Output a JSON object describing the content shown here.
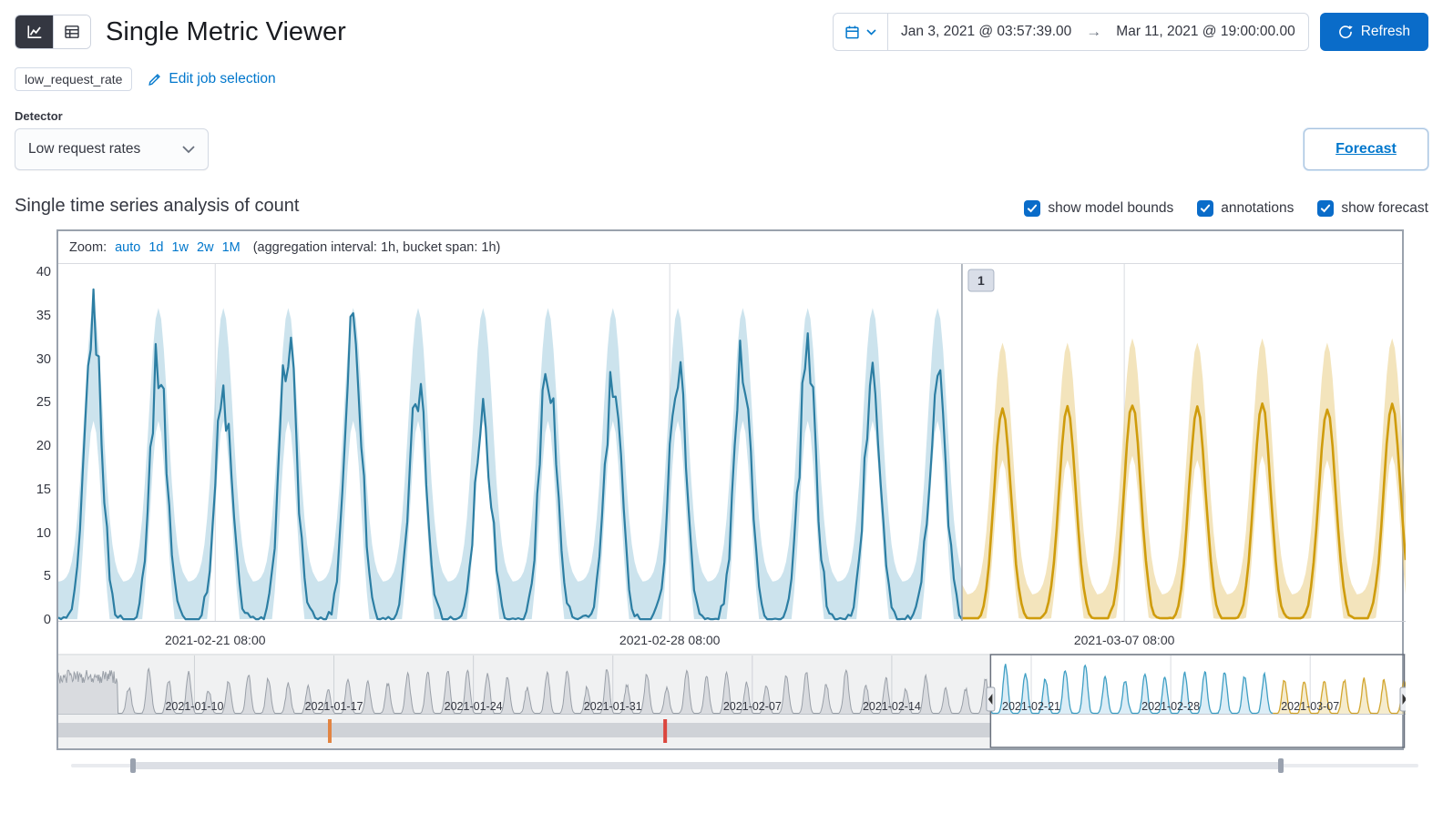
{
  "colors": {
    "primary": "#0a6cc9",
    "link": "#0077cc",
    "text": "#343741",
    "gridline": "#d8dbe0",
    "panel_border": "#9aa2ad",
    "actual_line": "#2c7ea3",
    "actual_band": "#8fc0d6",
    "forecast_line": "#cf9c0c",
    "forecast_band": "#e8ca7a",
    "context_line": "#9aa0a9",
    "context_fill": "#e4e5e9",
    "context_actual_line": "#3f9fc4",
    "context_actual_fill": "#bfdfee",
    "context_forecast_line": "#d2a52e",
    "context_forecast_fill": "#eedfad",
    "annotation_badge_bg": "#d9dee8",
    "swimlane_track": "#d9dbe0",
    "mask": "#98a0ab",
    "selection_border": "#69707d"
  },
  "header": {
    "title": "Single Metric Viewer",
    "refresh_label": "Refresh",
    "time_range": {
      "start": "Jan 3, 2021 @ 03:57:39.00",
      "arrow": "→",
      "end": "Mar 11, 2021 @ 19:00:00.00"
    }
  },
  "job_bar": {
    "job_badge": "low_request_rate",
    "edit_link": "Edit job selection"
  },
  "detector": {
    "label": "Detector",
    "selected_option": "Low request rates"
  },
  "forecast_button_label": "Forecast",
  "analysis": {
    "heading": "Single time series analysis of count",
    "toggles": [
      {
        "label": "show model bounds",
        "checked": true
      },
      {
        "label": "annotations",
        "checked": true
      },
      {
        "label": "show forecast",
        "checked": true
      }
    ]
  },
  "zoom_bar": {
    "label": "Zoom:",
    "options": [
      "auto",
      "1d",
      "1w",
      "2w",
      "1M"
    ],
    "note": "(aggregation interval: 1h, bucket span: 1h)"
  },
  "chart_data": {
    "type": "line",
    "title": "Single time series analysis of count",
    "ylabel": "count",
    "ylim": [
      0,
      40
    ],
    "yticks": [
      0,
      5,
      10,
      15,
      20,
      25,
      30,
      35,
      40
    ],
    "x_total_hours": 498,
    "xticks": [
      {
        "hour": 58,
        "label": "2021-02-21 08:00"
      },
      {
        "hour": 226,
        "label": "2021-02-28 08:00"
      },
      {
        "hour": 394,
        "label": "2021-03-07 08:00"
      }
    ],
    "daily_period_hours": 24,
    "peak_center_hour": 13,
    "forecast_start_hour": 334,
    "series": [
      {
        "name": "actual count",
        "kind": "line_with_model_bounds",
        "daily_peaks": [
          35,
          30,
          25.5,
          32.5,
          35,
          26.5,
          24,
          30,
          27,
          29.5,
          30.5,
          30,
          27,
          28.5
        ],
        "bounds_peak_upper": 36,
        "bounds_trough_upper": 4.5
      },
      {
        "name": "forecast",
        "kind": "line_with_confidence_band",
        "daily_peaks": [
          24.5,
          24.5,
          25,
          24.5,
          25,
          24.5,
          25
        ],
        "bounds_peak_upper": 32.5,
        "bounds_trough_upper": 3
      }
    ],
    "annotations": [
      {
        "label": "1",
        "hour": 334
      }
    ]
  },
  "context_chart": {
    "total_hours": 1623,
    "first_tick_hour": 164,
    "tick_interval_hours": 168,
    "xticks": [
      "2021-01-10",
      "2021-01-17",
      "2021-01-24",
      "2021-01-31",
      "2021-02-07",
      "2021-02-14",
      "2021-02-21",
      "2021-02-28",
      "2021-03-07"
    ],
    "selection_start_hour": 1123,
    "forecast_start_hour": 1463,
    "swimlane_marks": [
      {
        "severity": "major",
        "color": "#ef7f31",
        "hour": 327
      },
      {
        "severity": "critical",
        "color": "#e7372c",
        "hour": 731
      }
    ]
  },
  "scrollbar": {
    "start_frac": 0.046,
    "end_frac": 0.898
  }
}
